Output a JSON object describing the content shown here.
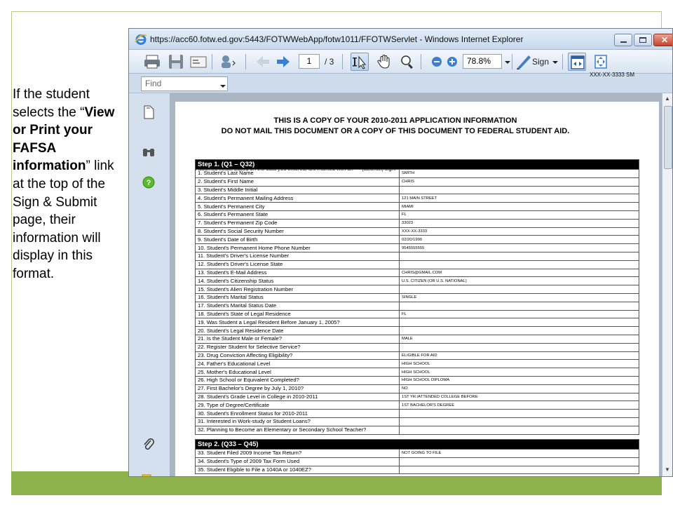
{
  "caption": {
    "part1": "If the student selects the “",
    "bold": "View or Print your FAFSA information",
    "part2": "” link at the top of the Sign & Submit page, their information will display in this format."
  },
  "window": {
    "title": "https://acc60.fotw.ed.gov:5443/FOTWWebApp/fotw1011/FFOTWServlet - Windows Internet Explorer"
  },
  "toolbar": {
    "page_current": "1",
    "page_total": "/ 3",
    "zoom": "78.8%",
    "sign_label": "Sign"
  },
  "findbar": {
    "placeholder": "Find"
  },
  "document": {
    "ssn_corner": "XXX-XX-3333 SM",
    "heading1": "THIS IS A COPY OF YOUR 2010-2011 APPLICATION INFORMATION",
    "heading2": "DO NOT MAIL THIS DOCUMENT OR A COPY OF THIS DOCUMENT TO FEDERAL STUDENT AID.",
    "note": "Assumed fields, based on the data you entered, are marked with an \"*\" (asterisk) sign.",
    "step1": {
      "title": "Step 1. (Q1 – Q32)",
      "rows": [
        {
          "q": "1. Student's Last Name",
          "a": "SMITH"
        },
        {
          "q": "2. Student's First Name",
          "a": "CHRIS"
        },
        {
          "q": "3. Student's Middle Initial",
          "a": ""
        },
        {
          "q": "4. Student's Permanent Mailing Address",
          "a": "121 MAIN STREET"
        },
        {
          "q": "5. Student's Permanent City",
          "a": "MIAMI"
        },
        {
          "q": "6. Student's Permanent State",
          "a": "FL"
        },
        {
          "q": "7. Student's Permanent Zip Code",
          "a": "33023"
        },
        {
          "q": "8. Student's Social Security Number",
          "a": "XXX-XX-3333"
        },
        {
          "q": "9. Student's Date of Birth",
          "a": "02/20/1990"
        },
        {
          "q": "10. Student's Permanent Home Phone Number",
          "a": "9545555555"
        },
        {
          "q": "11. Student's Driver's License Number",
          "a": ""
        },
        {
          "q": "12. Student's Driver's License State",
          "a": ""
        },
        {
          "q": "13. Student's E-Mail Address",
          "a": "CHRIS@GMAIL.COM"
        },
        {
          "q": "14. Student's Citizenship Status",
          "a": "U.S. CITIZEN (OR U.S. NATIONAL)"
        },
        {
          "q": "15. Student's Alien Registration Number",
          "a": ""
        },
        {
          "q": "16. Student's Marital Status",
          "a": "SINGLE"
        },
        {
          "q": "17. Student's Marital Status Date",
          "a": ""
        },
        {
          "q": "18. Student's State of Legal Residence",
          "a": "FL"
        },
        {
          "q": "19. Was Student a Legal Resident Before January 1, 2005?",
          "a": ""
        },
        {
          "q": "20. Student's Legal Residence Date",
          "a": ""
        },
        {
          "q": "21. Is the Student Male or Female?",
          "a": "MALE"
        },
        {
          "q": "22. Register Student for Selective Service?",
          "a": ""
        },
        {
          "q": "23. Drug Conviction Affecting Eligibility?",
          "a": "ELIGIBLE FOR AID"
        },
        {
          "q": "24. Father's Educational Level",
          "a": "HIGH SCHOOL"
        },
        {
          "q": "25. Mother's Educational Level",
          "a": "HIGH SCHOOL"
        },
        {
          "q": "26. High School or Equivalent Completed?",
          "a": "HIGH SCHOOL DIPLOMA"
        },
        {
          "q": "27. First Bachelor's Degree by July 1, 2010?",
          "a": "NO"
        },
        {
          "q": "28. Student's Grade Level in College in 2010-2011",
          "a": "1ST YR./ATTENDED COLLEGE BEFORE"
        },
        {
          "q": "29. Type of Degree/Certificate",
          "a": "1ST BACHELOR'S DEGREE"
        },
        {
          "q": "30. Student's Enrollment Status for 2010-2011",
          "a": ""
        },
        {
          "q": "31. Interested in Work-study or Student Loans?",
          "a": ""
        },
        {
          "q": "32. Planning to Become an Elementary or Secondary School Teacher?",
          "a": ""
        }
      ]
    },
    "step2": {
      "title": "Step 2. (Q33 – Q45)",
      "rows": [
        {
          "q": "33. Student Filed 2009 Income Tax Return?",
          "a": "NOT GOING TO FILE"
        },
        {
          "q": "34. Student's Type of 2009 Tax Form Used",
          "a": ""
        },
        {
          "q": "35. Student Eligible to File a 1040A or 1040EZ?",
          "a": ""
        }
      ]
    }
  }
}
